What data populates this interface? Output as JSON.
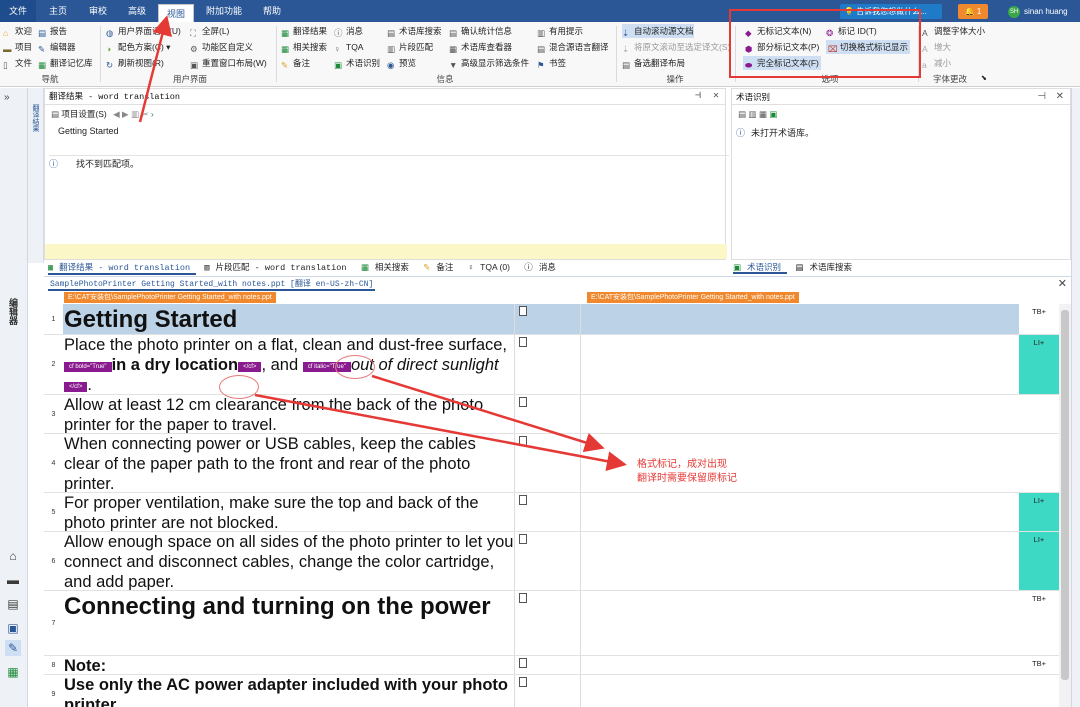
{
  "tabs": [
    "文件",
    "主页",
    "审校",
    "高级",
    "视图",
    "附加功能",
    "帮助"
  ],
  "tellme": "告诉我您想做什么...",
  "notif": "1",
  "user": {
    "initials": "SH",
    "name": "sinan huang"
  },
  "ribbon": {
    "g1": [
      "欢迎",
      "项目",
      "文件"
    ],
    "g1b": [
      "报告",
      "编辑器",
      "翻译记忆库"
    ],
    "g1_label": "导航",
    "g2": [
      "用户界面语言(U)",
      "配色方案(C)",
      "刷新视图(R)"
    ],
    "g2b": [
      "全屏(L)",
      "功能区自定义",
      "重置窗口布局(W)"
    ],
    "g2_label": "用户界面",
    "g3": [
      "翻译结果",
      "相关搜索",
      "备注"
    ],
    "g3b": [
      "消息",
      "TQA",
      "术语识别"
    ],
    "g3c": [
      "术语库搜索",
      "片段匹配",
      "预览"
    ],
    "g4": [
      "确认统计信息",
      "术语库查看器",
      "高级显示筛选条件"
    ],
    "g3_label": "信息",
    "g5": [
      "有用提示",
      "混合源语言翻译",
      "书签"
    ],
    "g6": [
      "自动滚动源文档",
      "将原文滚动至选定译文(S)",
      "备选翻译布局"
    ],
    "g6_label": "操作",
    "g7": [
      "无标记文本(N)",
      "部分标记文本(P)",
      "完全标记文本(F)"
    ],
    "g7b": [
      "标记 ID(T)",
      "切换格式标记显示"
    ],
    "g7_label": "选项",
    "g8": [
      "调整字体大小",
      "增大",
      "减小"
    ],
    "g8_label": "字体更改"
  },
  "left_strip": {
    "top_label": "翻译结果",
    "editor_label": "编辑器"
  },
  "tb_panel": {
    "title": "翻译结果 - word translation",
    "tool_label": "项目设置(S)",
    "source": "Getting Started",
    "message": "找不到匹配项。"
  },
  "term_panel": {
    "title": "术语识别",
    "message": "未打开术语库。"
  },
  "panel_tabs_left": [
    "翻译结果 - word translation",
    "片段匹配 - word translation",
    "相关搜索",
    "备注",
    "TQA (0)",
    "消息"
  ],
  "panel_tabs_right": [
    "术语识别",
    "术语库搜索"
  ],
  "editor": {
    "doc_tab": "SamplePhotoPrinter Getting Started_with notes.ppt [翻译 en-US-zh-CN]",
    "path_left": "E:\\CAT安装包\\SamplePhotoPrinter Getting Started_with notes.ppt",
    "path_right": "E:\\CAT安装包\\SamplePhotoPrinter Getting Started_with notes.ppt",
    "tags": {
      "open_bold": "cf bold=\"True\"",
      "open_italic": "cf italic=\"True\"",
      "close": "</cf>"
    },
    "rows": [
      {
        "n": "1",
        "text": "Getting Started",
        "status": "TB+"
      },
      {
        "n": "2",
        "parts": [
          "Place the photo printer on a flat, clean and dust-free surface, ",
          "in a dry location",
          ", and ",
          "out of direct sunlight",
          "."
        ],
        "status": "LI+"
      },
      {
        "n": "3",
        "text": "Allow at least 12 cm clearance from the back of the photo printer for the paper to travel.",
        "status": ""
      },
      {
        "n": "4",
        "text": "When connecting power or USB cables, keep the cables clear of the paper path to the front and rear of the photo printer.",
        "status": ""
      },
      {
        "n": "5",
        "text": "For proper ventilation, make sure the top and back of the photo printer are not blocked.",
        "status": "LI+"
      },
      {
        "n": "6",
        "text": "Allow enough space on all sides of the photo printer to let you connect and disconnect cables, change the color cartridge, and add paper.",
        "status": "LI+"
      },
      {
        "n": "7",
        "text": "Connecting and turning on the power",
        "status": "TB+"
      },
      {
        "n": "8",
        "text": "Note:",
        "status": "TB+"
      },
      {
        "n": "9",
        "text": "Use only the AC power adapter included with your photo printer.",
        "status": ""
      }
    ]
  },
  "annotation": [
    "格式标记，成对出现",
    "翻译时需要保留原标记"
  ],
  "colors": {
    "accent": "#2b5797",
    "tag": "#8a1b8e",
    "green_status": "#3dd9c4",
    "annotation": "#e53935",
    "selected_row": "#bcd2e6"
  }
}
